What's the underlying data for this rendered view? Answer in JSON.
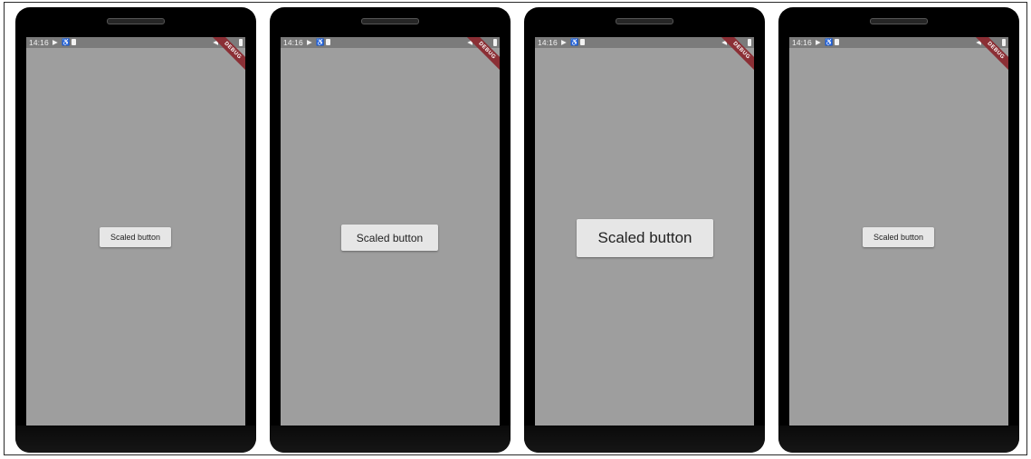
{
  "status": {
    "time": "14:16",
    "debug_label": "DEBUG"
  },
  "phones": [
    {
      "button_label": "Scaled button"
    },
    {
      "button_label": "Scaled button"
    },
    {
      "button_label": "Scaled button"
    },
    {
      "button_label": "Scaled button"
    }
  ],
  "colors": {
    "screen_bg": "#9e9e9e",
    "status_bar_bg": "#7b7b7b",
    "button_bg": "#e6e6e6",
    "debug_ribbon": "#8b2f35"
  }
}
